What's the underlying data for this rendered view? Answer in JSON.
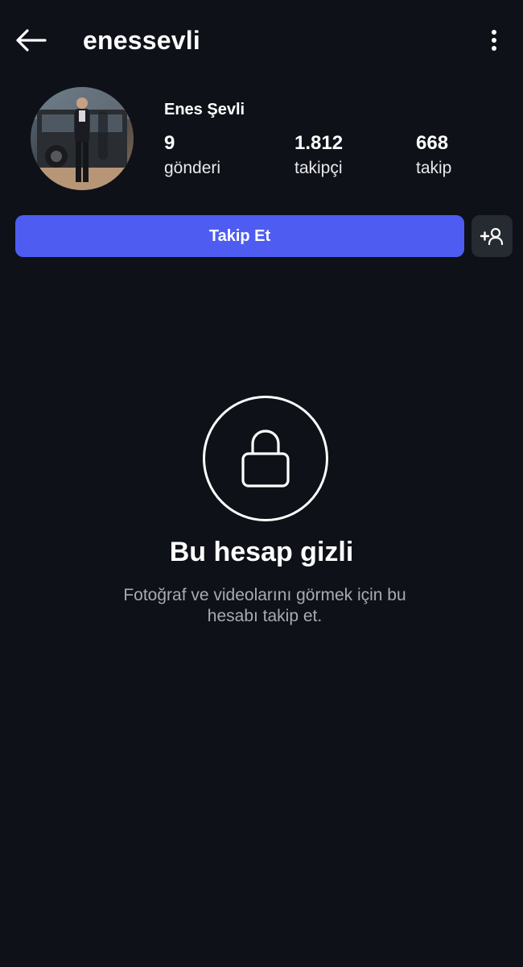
{
  "header": {
    "username": "enessevli"
  },
  "profile": {
    "display_name": "Enes Şevli",
    "stats": [
      {
        "count": "9",
        "label": "gönderi"
      },
      {
        "count": "1.812",
        "label": "takipçi"
      },
      {
        "count": "668",
        "label": "takip"
      }
    ]
  },
  "actions": {
    "follow_label": "Takip Et"
  },
  "private_account": {
    "title": "Bu hesap gizli",
    "description": "Fotoğraf ve videolarını görmek için bu hesabı takip et."
  },
  "icons": {
    "back": "back-arrow-icon",
    "more": "more-vertical-icon",
    "add_user": "add-user-icon",
    "lock": "lock-icon"
  },
  "colors": {
    "background": "#0e1117",
    "accent": "#4f5cf2",
    "secondary_button": "#262a31",
    "muted_text": "#a7abb3"
  }
}
